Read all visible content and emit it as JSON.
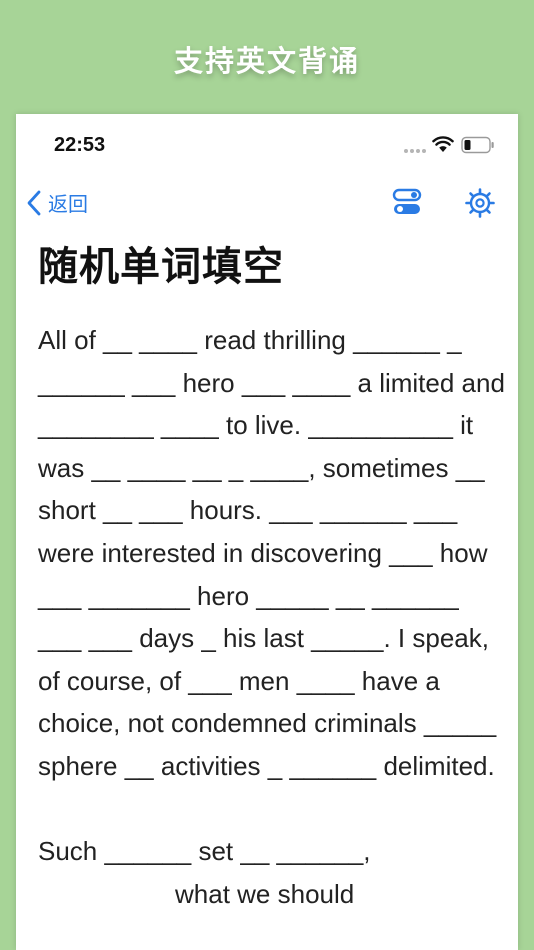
{
  "banner": {
    "title": "支持英文背诵"
  },
  "status_bar": {
    "time": "22:53"
  },
  "nav": {
    "back_label": "返回"
  },
  "page": {
    "title": "随机单词填空"
  },
  "passage": {
    "paragraph1": "All of __ ____ read thrilling ______ _ ______ ___ hero ___ ____ a limited and ________ ____ to live. __________ it was __ ____ __ _ ____, sometimes __ short __ ___ hours. ___ ______ ___ were interested in discovering ___ how ___ _______ hero _____ __ ______ ___ ___ days _ his last _____. I speak, of course, of ___ men ____ have a choice, not condemned criminals _____ sphere __ activities _ ______ delimited.",
    "paragraph2_line1": "Such ______ set __ ______,",
    "paragraph2_line2": "what we should"
  },
  "colors": {
    "background": "#a7d497",
    "accent": "#2a7be4",
    "text": "#222222"
  }
}
